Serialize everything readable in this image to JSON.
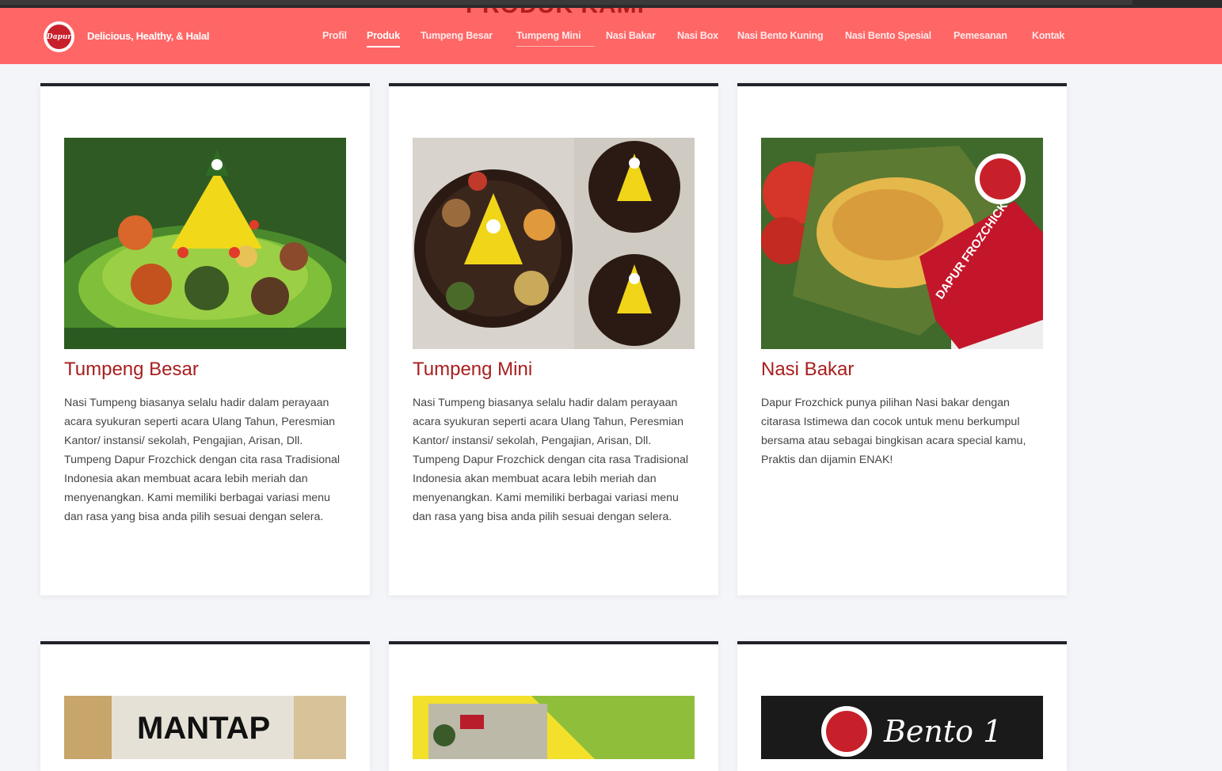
{
  "header": {
    "tagline": "Delicious, Healthy, & Halal",
    "logo_text": "Dapur",
    "page_heading": "PRODUK KAMI"
  },
  "nav": {
    "items": [
      {
        "label": "Profil"
      },
      {
        "label": "Produk"
      },
      {
        "label": "Tumpeng Besar"
      },
      {
        "label": "Tumpeng Mini"
      },
      {
        "label": "Nasi Bakar"
      },
      {
        "label": "Nasi Box"
      },
      {
        "label": "Nasi Bento Kuning"
      },
      {
        "label": "Nasi Bento Spesial"
      },
      {
        "label": "Pemesanan"
      },
      {
        "label": "Kontak"
      }
    ]
  },
  "products": [
    {
      "title": "Tumpeng Besar",
      "description": "Nasi Tumpeng biasanya selalu hadir dalam perayaan acara syukuran seperti acara Ulang Tahun, Peresmian Kantor/ instansi/ sekolah, Pengajian, Arisan, Dll. Tumpeng Dapur Frozchick dengan cita rasa Tradisional Indonesia akan membuat acara lebih meriah dan menyenangkan. Kami memiliki berbagai variasi menu dan rasa yang bisa anda pilih sesuai dengan selera."
    },
    {
      "title": "Tumpeng Mini",
      "description": "Nasi Tumpeng biasanya selalu hadir dalam perayaan acara syukuran seperti acara Ulang Tahun, Peresmian Kantor/ instansi/ sekolah, Pengajian, Arisan, Dll. Tumpeng Dapur Frozchick dengan cita rasa Tradisional Indonesia akan membuat acara lebih meriah dan menyenangkan. Kami memiliki berbagai variasi menu dan rasa yang bisa anda pilih sesuai dengan selera."
    },
    {
      "title": "Nasi Bakar",
      "description": "Dapur Frozchick punya pilihan Nasi bakar dengan citarasa Istimewa dan cocok untuk menu berkumpul bersama atau sebagai bingkisan acara special kamu, Praktis dan dijamin ENAK!"
    }
  ],
  "image_text": {
    "nasi_bakar_pack": "DAPUR FROZCHICK",
    "row2_card1": "MANTAP",
    "row2_card3": "Bento 1"
  }
}
